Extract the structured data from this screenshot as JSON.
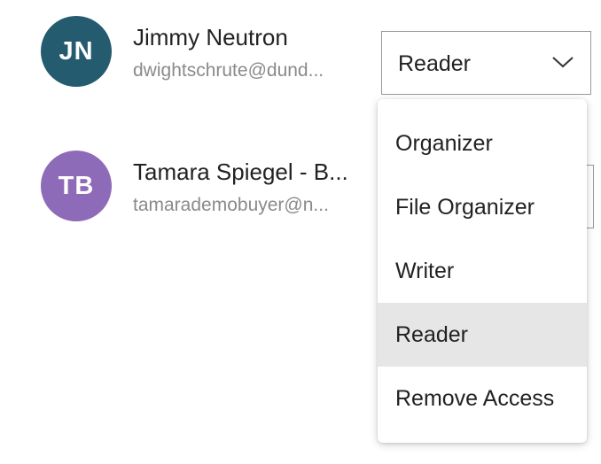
{
  "users": [
    {
      "initials": "JN",
      "name": "Jimmy Neutron",
      "email": "dwightschrute@dund...",
      "avatar_color": "#245b6e",
      "role": "Reader"
    },
    {
      "initials": "TB",
      "name": "Tamara Spiegel - B...",
      "email": "tamarademobuyer@n...",
      "avatar_color": "#8e6bb8"
    }
  ],
  "role_menu": {
    "items": [
      {
        "label": "Organizer"
      },
      {
        "label": "File Organizer"
      },
      {
        "label": "Writer"
      },
      {
        "label": "Reader",
        "selected": true
      },
      {
        "label": "Remove Access"
      }
    ],
    "selected_highlight_color": "#e6e6e6",
    "chevron_icon": "chevron-down-icon"
  }
}
